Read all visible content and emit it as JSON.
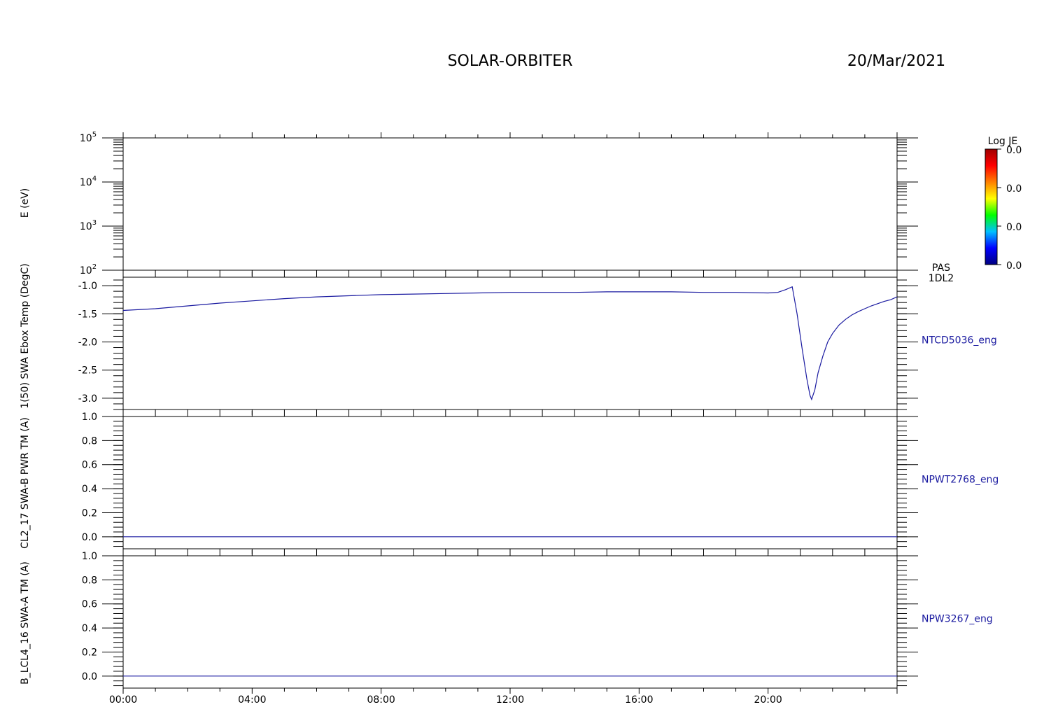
{
  "header": {
    "mission": "SOLAR-ORBITER",
    "date": "20/Mar/2021"
  },
  "colorbar": {
    "title": "Log JE",
    "tick_labels": [
      "0.0",
      "0.0",
      "0.0",
      "0.0"
    ],
    "colors": [
      "#000080",
      "#0000ff",
      "#00c0ff",
      "#00ff00",
      "#ffff00",
      "#ff8000",
      "#ff0000",
      "#a00000"
    ]
  },
  "chart_data": [
    {
      "type": "heatmap",
      "ylabel": "E (eV)",
      "y_scale": "log",
      "ylim": [
        100,
        100000
      ],
      "y_tick_labels": [
        {
          "base": "10",
          "exp": "2"
        },
        {
          "base": "10",
          "exp": "3"
        },
        {
          "base": "10",
          "exp": "4"
        },
        {
          "base": "10",
          "exp": "5"
        }
      ],
      "right_label": [
        "PAS",
        "1DL2"
      ],
      "values": []
    },
    {
      "type": "line",
      "ylabel": "1(50) SWA Ebox Temp (DegC)",
      "series_label": "NTCD5036_eng",
      "ylim": [
        -3.2,
        -0.85
      ],
      "y_ticks": [
        -1.0,
        -1.5,
        -2.0,
        -2.5,
        -3.0
      ],
      "y_tick_labels": [
        "-1.0",
        "-1.5",
        "-2.0",
        "-2.5",
        "-3.0"
      ],
      "color": "#1a1aa0",
      "x_hours": [
        0,
        1,
        2,
        3,
        4,
        5,
        6,
        7,
        8,
        9,
        10,
        11,
        12,
        13,
        14,
        15,
        16,
        17,
        18,
        19,
        20,
        20.3,
        20.55,
        20.75,
        20.9,
        21.05,
        21.2,
        21.3,
        21.35,
        21.45,
        21.55,
        21.7,
        21.85,
        22.0,
        22.2,
        22.4,
        22.6,
        22.8,
        23.0,
        23.2,
        23.4,
        23.6,
        23.8,
        24.0
      ],
      "y": [
        -1.44,
        -1.41,
        -1.36,
        -1.31,
        -1.27,
        -1.23,
        -1.2,
        -1.18,
        -1.16,
        -1.15,
        -1.14,
        -1.13,
        -1.12,
        -1.12,
        -1.12,
        -1.11,
        -1.11,
        -1.11,
        -1.12,
        -1.12,
        -1.13,
        -1.12,
        -1.07,
        -1.02,
        -1.5,
        -2.1,
        -2.65,
        -2.95,
        -3.02,
        -2.85,
        -2.55,
        -2.25,
        -2.0,
        -1.85,
        -1.7,
        -1.6,
        -1.52,
        -1.46,
        -1.41,
        -1.36,
        -1.32,
        -1.28,
        -1.25,
        -1.2
      ]
    },
    {
      "type": "line",
      "ylabel": "CL2_17 SWA-B PWR TM (A)",
      "series_label": "NPWT2768_eng",
      "ylim": [
        -0.1,
        1.0
      ],
      "y_ticks": [
        0.0,
        0.2,
        0.4,
        0.6,
        0.8,
        1.0
      ],
      "y_tick_labels": [
        "0.0",
        "0.2",
        "0.4",
        "0.6",
        "0.8",
        "1.0"
      ],
      "color": "#1a1aa0",
      "x_hours": [
        0,
        24
      ],
      "y": [
        0.0,
        0.0
      ]
    },
    {
      "type": "line",
      "ylabel": "B_LCL4_16 SWA-A TM (A)",
      "series_label": "NPW3267_eng",
      "ylim": [
        -0.1,
        1.0
      ],
      "y_ticks": [
        0.0,
        0.2,
        0.4,
        0.6,
        0.8,
        1.0
      ],
      "y_tick_labels": [
        "0.0",
        "0.2",
        "0.4",
        "0.6",
        "0.8",
        "1.0"
      ],
      "color": "#1a1aa0",
      "x_hours": [
        0,
        24
      ],
      "y": [
        0.0,
        0.0
      ]
    }
  ],
  "x_axis": {
    "tick_hours": [
      0,
      4,
      8,
      12,
      16,
      20
    ],
    "tick_labels": [
      "00:00",
      "04:00",
      "08:00",
      "12:00",
      "16:00",
      "20:00"
    ],
    "range_hours": [
      0,
      24
    ]
  }
}
